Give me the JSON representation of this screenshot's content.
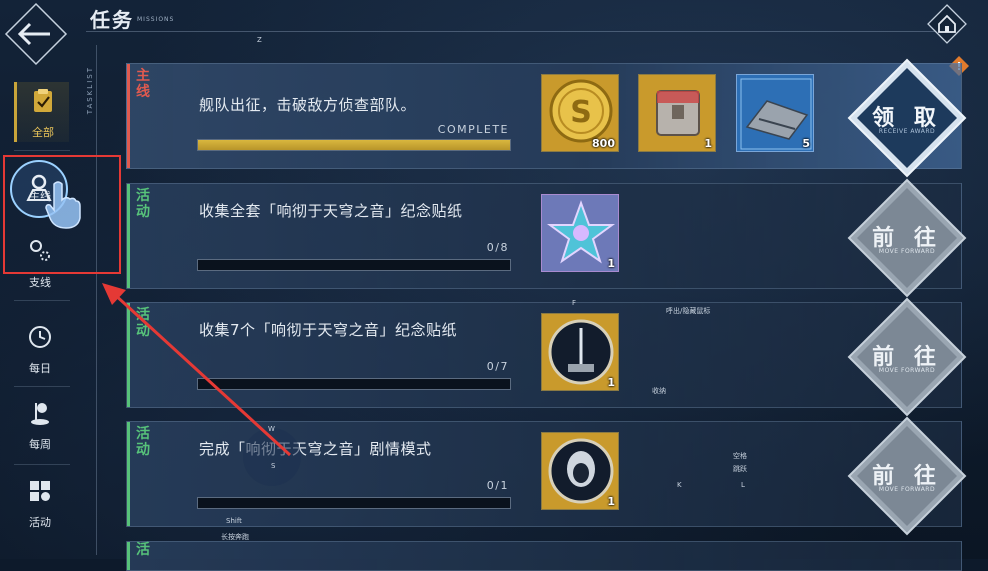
{
  "header": {
    "title": "任务",
    "subtitle": "MISSIONS"
  },
  "sidebar": {
    "vertical_label": "TASKLIST",
    "items": [
      {
        "label": "全部",
        "icon": "clipboard-icon",
        "selected": true
      },
      {
        "label": "主线",
        "icon": "location-pin-icon",
        "selected": false
      },
      {
        "label": "支线",
        "icon": "branch-pin-icon",
        "selected": false
      },
      {
        "label": "每日",
        "icon": "clock-icon",
        "selected": false
      },
      {
        "label": "每周",
        "icon": "flag-icon",
        "selected": false
      },
      {
        "label": "活动",
        "icon": "grid-icon",
        "selected": false
      }
    ]
  },
  "tasks": [
    {
      "category": "主线",
      "category_color": "#e05a4f",
      "text": "舰队出征，击破敌方侦查部队。",
      "progress_text": "COMPLETE",
      "progress": 1.0,
      "rewards": [
        {
          "icon": "gold-coin-icon",
          "count": "800"
        },
        {
          "icon": "supply-box-icon",
          "count": "1"
        },
        {
          "icon": "battleship-icon",
          "count": "5"
        }
      ],
      "action": {
        "label": "领 取",
        "sub": "RECEIVE AWARD"
      }
    },
    {
      "category": "活动",
      "category_color": "#57c27a",
      "text": "收集全套「响彻于天穹之音」纪念贴纸",
      "progress_text": "0/8",
      "progress": 0,
      "rewards": [
        {
          "icon": "star-sticker-icon",
          "count": "1"
        }
      ],
      "action": {
        "label": "前 往",
        "sub": "MOVE FORWARD"
      }
    },
    {
      "category": "活动",
      "category_color": "#57c27a",
      "text": "收集7个「响彻于天穹之音」纪念贴纸",
      "progress_text": "0/7",
      "progress": 0,
      "rewards": [
        {
          "icon": "tower-badge-icon",
          "count": "1"
        }
      ],
      "action": {
        "label": "前 往",
        "sub": "MOVE FORWARD"
      }
    },
    {
      "category": "活动",
      "category_color": "#57c27a",
      "text": "完成「响彻于天穹之音」剧情模式",
      "progress_text": "0/1",
      "progress": 0,
      "rewards": [
        {
          "icon": "character-badge-icon",
          "count": "1"
        }
      ],
      "action": {
        "label": "前 往",
        "sub": "MOVE FORWARD"
      }
    },
    {
      "category": "活",
      "category_color": "#57c27a"
    }
  ],
  "key_hints": {
    "z": "Z",
    "f": "F",
    "w": "W",
    "s": "S",
    "k": "K",
    "l": "L",
    "mouse_label": "呼出/隐藏鼠标",
    "fold_label": "收纳",
    "space_label": "空格",
    "jump_label": "跳跃",
    "shift_label": "Shift",
    "sprint_label": "长按奔跑"
  },
  "colors": {
    "gold": "#c9a53a",
    "annotation_red": "#e53935"
  }
}
